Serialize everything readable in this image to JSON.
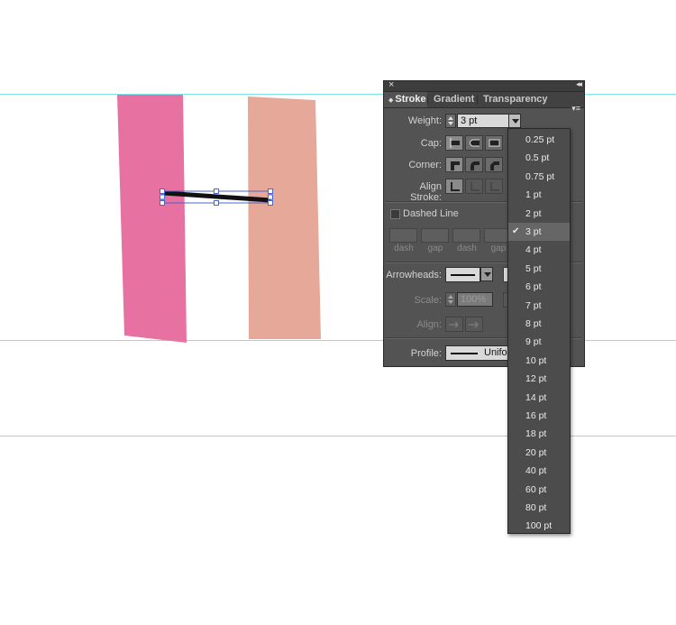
{
  "panel": {
    "close_icon": "×",
    "collapse_icon": "◂◂",
    "menu_icon": "▾≡",
    "tabs": [
      {
        "label": "Stroke",
        "active": true
      },
      {
        "label": "Gradient",
        "active": false
      },
      {
        "label": "Transparency",
        "active": false
      }
    ],
    "weight_label": "Weight:",
    "weight_value": "3 pt",
    "cap_label": "Cap:",
    "corner_label": "Corner:",
    "align_label": "Align Stroke:",
    "dashed_label": "Dashed Line",
    "dash_labels": [
      "dash",
      "gap",
      "dash",
      "gap"
    ],
    "arrowheads_label": "Arrowheads:",
    "scale_label": "Scale:",
    "scale_value": "100%",
    "align2_label": "Align:",
    "profile_label": "Profile:",
    "profile_value": "Unifo"
  },
  "weight_dropdown": {
    "selected": "3 pt",
    "options": [
      "0.25 pt",
      "0.5 pt",
      "0.75 pt",
      "1 pt",
      "2 pt",
      "3 pt",
      "4 pt",
      "5 pt",
      "6 pt",
      "7 pt",
      "8 pt",
      "9 pt",
      "10 pt",
      "12 pt",
      "14 pt",
      "16 pt",
      "18 pt",
      "20 pt",
      "40 pt",
      "60 pt",
      "80 pt",
      "100 pt"
    ]
  },
  "colors": {
    "shape_left": "#e772a2",
    "shape_right": "#e6a899",
    "guide": "#7fe3ef",
    "selection": "#4a66c8"
  },
  "misc": {
    "x_mark": "×"
  }
}
